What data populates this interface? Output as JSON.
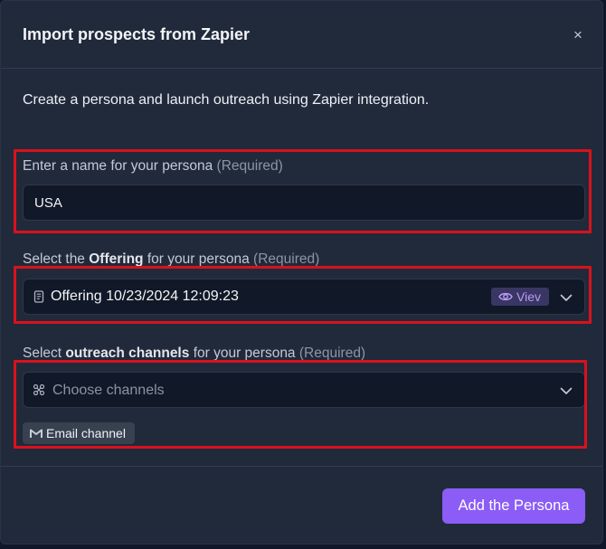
{
  "modal": {
    "title": "Import prospects from Zapier",
    "close_glyph": "×",
    "description": "Create a persona and launch outreach using Zapier integration."
  },
  "persona_name": {
    "label": "Enter a name for your persona",
    "required": "(Required)",
    "value": "USA"
  },
  "offering": {
    "label_prefix": "Select the",
    "label_bold": "Offering",
    "label_suffix": "for your persona",
    "required": "(Required)",
    "selected": "Offering 10/23/2024 12:09:23",
    "view_label": "Viev",
    "icon": "document-icon"
  },
  "channels": {
    "label_prefix": "Select",
    "label_bold": "outreach channels",
    "label_suffix": "for your persona",
    "required": "(Required)",
    "placeholder": "Choose channels",
    "icon": "channels-icon",
    "chips": [
      {
        "label": "Email channel",
        "icon": "gmail-icon"
      }
    ]
  },
  "actions": {
    "submit_label": "Add the Persona"
  },
  "colors": {
    "accent": "#8b5cf6",
    "highlight": "#d8121c",
    "panel": "#212a3b",
    "field": "#111827"
  }
}
